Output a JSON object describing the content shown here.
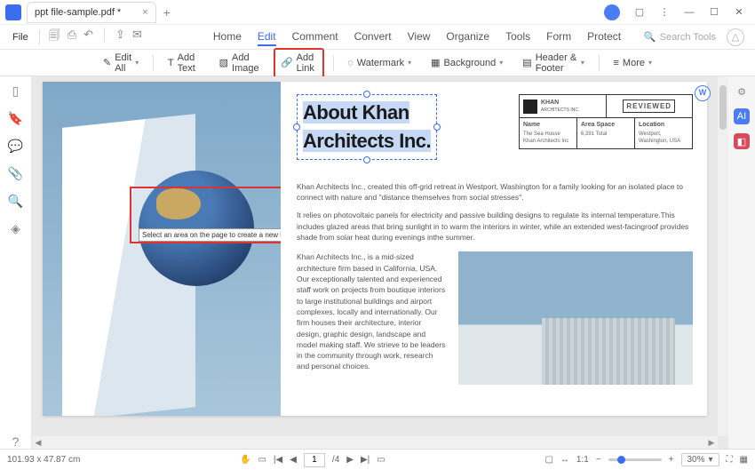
{
  "titlebar": {
    "tab_title": "ppt file-sample.pdf *"
  },
  "menubar": {
    "file": "File",
    "nav": [
      "Home",
      "Edit",
      "Comment",
      "Convert",
      "View",
      "Organize",
      "Tools",
      "Form",
      "Protect"
    ],
    "search_placeholder": "Search Tools"
  },
  "toolbar": {
    "edit_all": "Edit All",
    "add_text": "Add Text",
    "add_image": "Add Image",
    "add_link": "Add Link",
    "watermark": "Watermark",
    "background": "Background",
    "header_footer": "Header & Footer",
    "more": "More"
  },
  "left_sidebar": [
    "thumbnails",
    "bookmark",
    "comment",
    "attachment",
    "search",
    "layers"
  ],
  "document": {
    "title_line1": "About Khan",
    "title_line2": "Architects Inc.",
    "link_hint": "Select an area on the page to create a new link",
    "infobox": {
      "brand": "KHAN",
      "brand_sub": "ARCHITECTS INC.",
      "reviewed": "REVIEWED",
      "cells": [
        {
          "k": "Name",
          "v": "The Sea House Khan Architects Inc"
        },
        {
          "k": "Area Space",
          "v": "6,391 Total"
        },
        {
          "k": "Location",
          "v": "Westport, Washington, USA"
        }
      ]
    },
    "para1": "Khan Architects Inc., created this off-grid retreat in Westport, Washington for a family looking for an isolated place to connect with nature and \"distance themselves from social stresses\".",
    "para2": "It relies on photovoltaic panels for electricity and passive building designs to regulate its internal temperature.This includes glazed areas that bring sunlight in to warm the interiors in winter, while an extended west-facingroof provides shade from solar heat during evenings inthe summer.",
    "para3": "Khan Architects Inc., is a mid-sized architecture firm based in California, USA. Our exceptionally talented and experienced staff work on projects from boutique interiors to large institutional buildings and airport complexes, locally and internationally. Our firm houses their architecture, interior design, graphic design, landscape and model making staff. We strieve to be leaders in the community through work, research and personal choices."
  },
  "statusbar": {
    "coords": "101.93 x 47.87 cm",
    "page_current": "1",
    "page_total": "/4",
    "zoom": "30%"
  }
}
